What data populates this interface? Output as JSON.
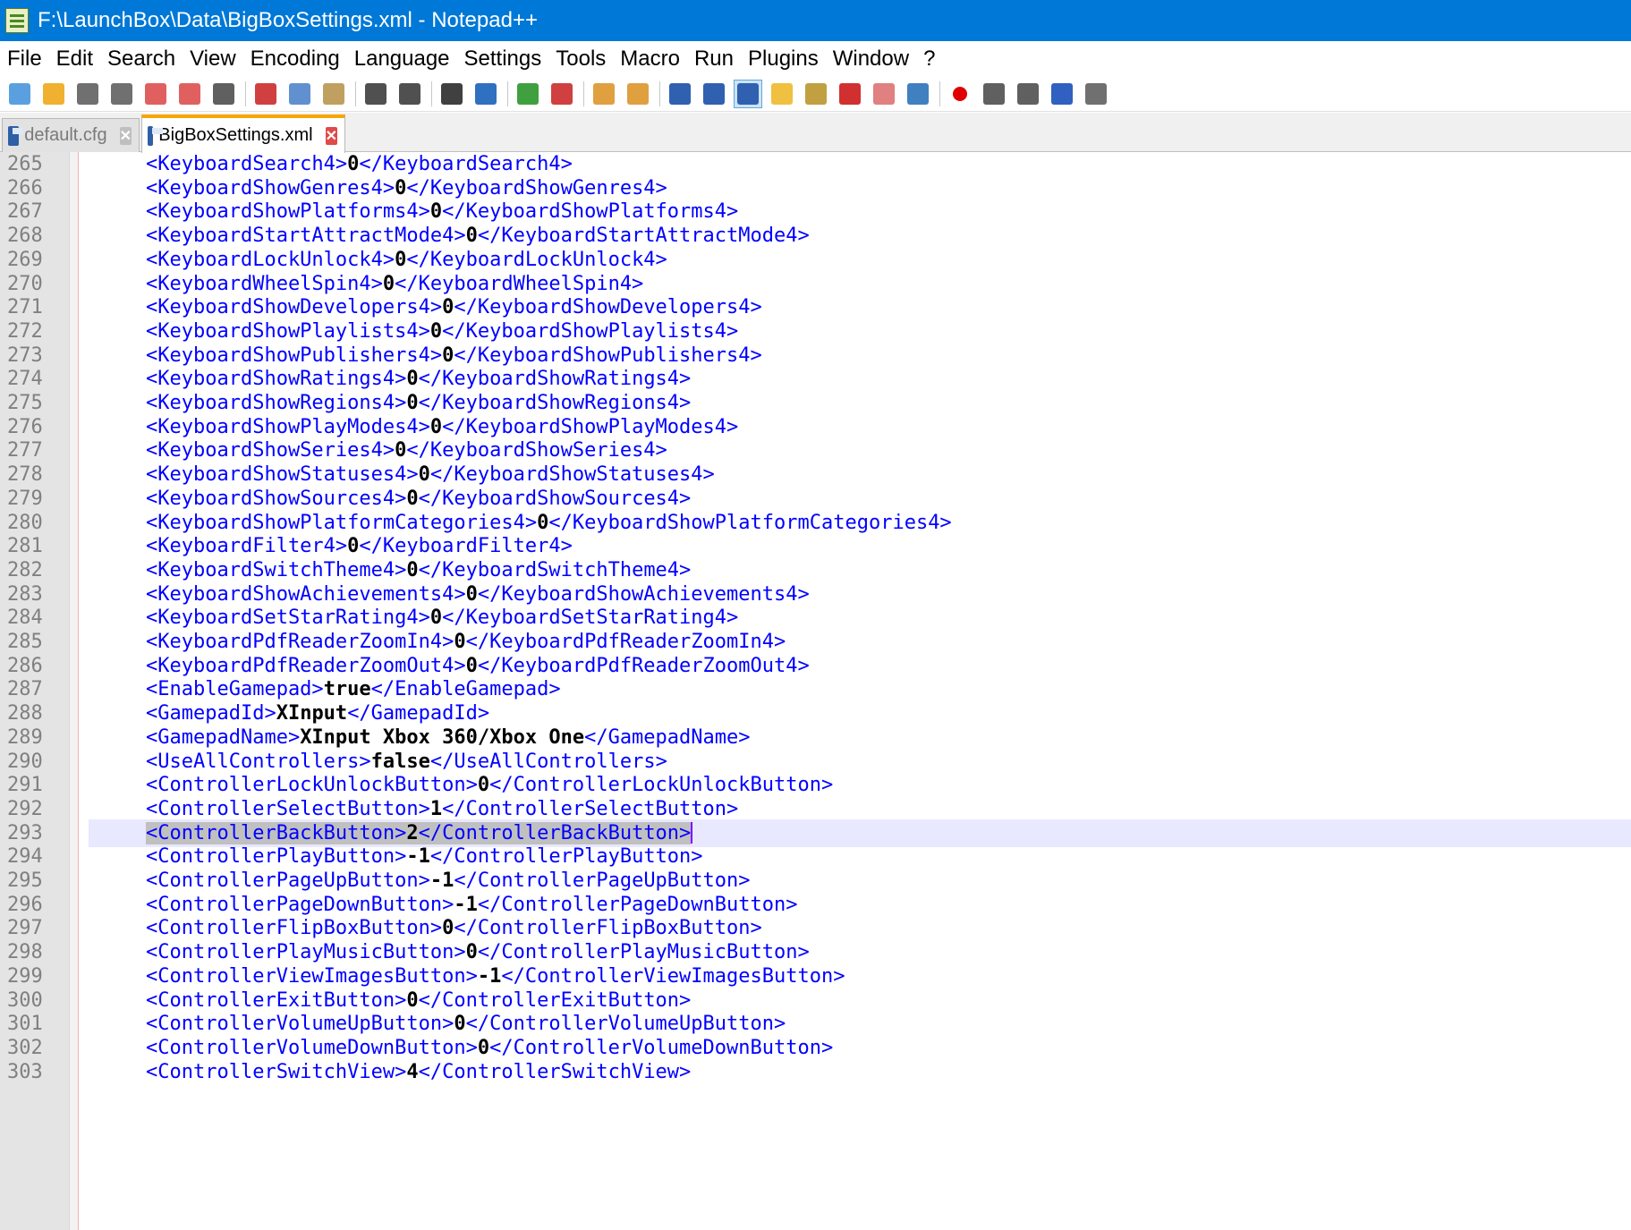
{
  "window": {
    "title": "F:\\LaunchBox\\Data\\BigBoxSettings.xml - Notepad++"
  },
  "menu": [
    "File",
    "Edit",
    "Search",
    "View",
    "Encoding",
    "Language",
    "Settings",
    "Tools",
    "Macro",
    "Run",
    "Plugins",
    "Window",
    "?"
  ],
  "toolbar": {
    "buttons": [
      {
        "icon": "new-file-icon",
        "color": "#5aa0e0"
      },
      {
        "icon": "open-file-icon",
        "color": "#f0b030"
      },
      {
        "icon": "save-icon",
        "color": "#707070"
      },
      {
        "icon": "save-all-icon",
        "color": "#707070"
      },
      {
        "icon": "close-icon",
        "color": "#e06060"
      },
      {
        "icon": "close-all-icon",
        "color": "#e06060"
      },
      {
        "icon": "print-icon",
        "color": "#606060"
      },
      {
        "sep": true
      },
      {
        "icon": "cut-icon",
        "color": "#d04040"
      },
      {
        "icon": "copy-icon",
        "color": "#6090d0"
      },
      {
        "icon": "paste-icon",
        "color": "#c0a060"
      },
      {
        "sep": true
      },
      {
        "icon": "undo-icon",
        "color": "#505050"
      },
      {
        "icon": "redo-icon",
        "color": "#505050"
      },
      {
        "sep": true
      },
      {
        "icon": "find-icon",
        "color": "#404040"
      },
      {
        "icon": "replace-icon",
        "color": "#3070c0"
      },
      {
        "sep": true
      },
      {
        "icon": "zoom-in-icon",
        "color": "#40a040"
      },
      {
        "icon": "zoom-out-icon",
        "color": "#d04040"
      },
      {
        "sep": true
      },
      {
        "icon": "sync-vertical-icon",
        "color": "#e0a040"
      },
      {
        "icon": "sync-horizontal-icon",
        "color": "#e0a040"
      },
      {
        "sep": true
      },
      {
        "icon": "word-wrap-icon",
        "color": "#3060b0"
      },
      {
        "icon": "show-all-characters-icon",
        "color": "#3060b0"
      },
      {
        "icon": "indent-guide-icon",
        "color": "#3060b0",
        "active": true
      },
      {
        "icon": "user-language-icon",
        "color": "#f0c040"
      },
      {
        "icon": "document-map-icon",
        "color": "#c0a040"
      },
      {
        "icon": "function-list-icon",
        "color": "#d03030"
      },
      {
        "icon": "folder-as-workspace-icon",
        "color": "#e08080"
      },
      {
        "icon": "monitoring-icon",
        "color": "#4080c0"
      },
      {
        "sep": true
      },
      {
        "icon": "record-macro-icon",
        "color": "#e00000"
      },
      {
        "icon": "stop-recording-icon",
        "color": "#606060"
      },
      {
        "icon": "playback-macro-icon",
        "color": "#606060"
      },
      {
        "icon": "run-macro-multiple-icon",
        "color": "#3060c0"
      },
      {
        "icon": "save-macro-icon",
        "color": "#707070"
      }
    ]
  },
  "tabs": [
    {
      "label": "default.cfg",
      "active": false
    },
    {
      "label": "BigBoxSettings.xml",
      "active": true
    }
  ],
  "editor": {
    "current_line": 293,
    "lines": [
      {
        "n": "265",
        "tag": "KeyboardSearch4",
        "value": "0"
      },
      {
        "n": "266",
        "tag": "KeyboardShowGenres4",
        "value": "0"
      },
      {
        "n": "267",
        "tag": "KeyboardShowPlatforms4",
        "value": "0"
      },
      {
        "n": "268",
        "tag": "KeyboardStartAttractMode4",
        "value": "0"
      },
      {
        "n": "269",
        "tag": "KeyboardLockUnlock4",
        "value": "0"
      },
      {
        "n": "270",
        "tag": "KeyboardWheelSpin4",
        "value": "0"
      },
      {
        "n": "271",
        "tag": "KeyboardShowDevelopers4",
        "value": "0"
      },
      {
        "n": "272",
        "tag": "KeyboardShowPlaylists4",
        "value": "0"
      },
      {
        "n": "273",
        "tag": "KeyboardShowPublishers4",
        "value": "0"
      },
      {
        "n": "274",
        "tag": "KeyboardShowRatings4",
        "value": "0"
      },
      {
        "n": "275",
        "tag": "KeyboardShowRegions4",
        "value": "0"
      },
      {
        "n": "276",
        "tag": "KeyboardShowPlayModes4",
        "value": "0"
      },
      {
        "n": "277",
        "tag": "KeyboardShowSeries4",
        "value": "0"
      },
      {
        "n": "278",
        "tag": "KeyboardShowStatuses4",
        "value": "0"
      },
      {
        "n": "279",
        "tag": "KeyboardShowSources4",
        "value": "0"
      },
      {
        "n": "280",
        "tag": "KeyboardShowPlatformCategories4",
        "value": "0"
      },
      {
        "n": "281",
        "tag": "KeyboardFilter4",
        "value": "0"
      },
      {
        "n": "282",
        "tag": "KeyboardSwitchTheme4",
        "value": "0"
      },
      {
        "n": "283",
        "tag": "KeyboardShowAchievements4",
        "value": "0"
      },
      {
        "n": "284",
        "tag": "KeyboardSetStarRating4",
        "value": "0"
      },
      {
        "n": "285",
        "tag": "KeyboardPdfReaderZoomIn4",
        "value": "0"
      },
      {
        "n": "286",
        "tag": "KeyboardPdfReaderZoomOut4",
        "value": "0"
      },
      {
        "n": "287",
        "tag": "EnableGamepad",
        "value": "true"
      },
      {
        "n": "288",
        "tag": "GamepadId",
        "value": "XInput"
      },
      {
        "n": "289",
        "tag": "GamepadName",
        "value": "XInput Xbox 360/Xbox One"
      },
      {
        "n": "290",
        "tag": "UseAllControllers",
        "value": "false"
      },
      {
        "n": "291",
        "tag": "ControllerLockUnlockButton",
        "value": "0"
      },
      {
        "n": "292",
        "tag": "ControllerSelectButton",
        "value": "1"
      },
      {
        "n": "293",
        "tag": "ControllerBackButton",
        "value": "2"
      },
      {
        "n": "294",
        "tag": "ControllerPlayButton",
        "value": "-1"
      },
      {
        "n": "295",
        "tag": "ControllerPageUpButton",
        "value": "-1"
      },
      {
        "n": "296",
        "tag": "ControllerPageDownButton",
        "value": "-1"
      },
      {
        "n": "297",
        "tag": "ControllerFlipBoxButton",
        "value": "0"
      },
      {
        "n": "298",
        "tag": "ControllerPlayMusicButton",
        "value": "0"
      },
      {
        "n": "299",
        "tag": "ControllerViewImagesButton",
        "value": "-1"
      },
      {
        "n": "300",
        "tag": "ControllerExitButton",
        "value": "0"
      },
      {
        "n": "301",
        "tag": "ControllerVolumeUpButton",
        "value": "0"
      },
      {
        "n": "302",
        "tag": "ControllerVolumeDownButton",
        "value": "0"
      },
      {
        "n": "303",
        "tag": "ControllerSwitchView",
        "value": "4"
      }
    ]
  }
}
